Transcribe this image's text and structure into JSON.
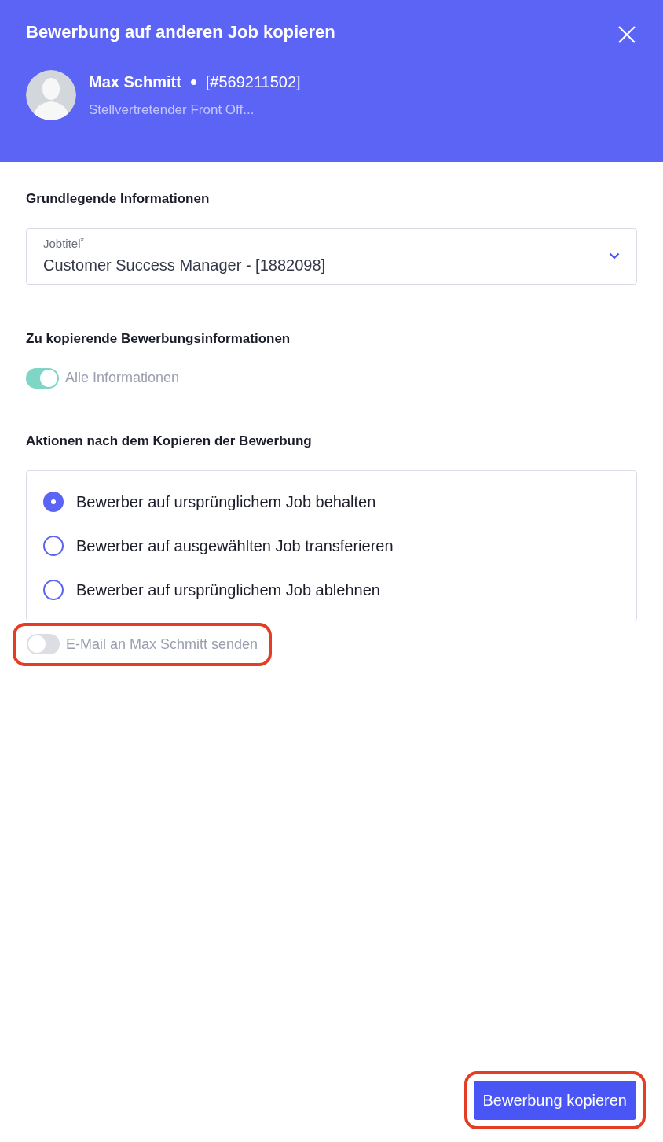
{
  "header": {
    "title": "Bewerbung auf anderen Job kopieren",
    "candidate": {
      "name": "Max Schmitt",
      "id": "[#569211502]",
      "position": "Stellvertretender Front Off..."
    }
  },
  "sections": [
    {
      "kind": "select",
      "heading": "Grundlegende Informationen",
      "label": "Jobtitel",
      "required_mark": "*",
      "value": "Customer Success Manager - [1882098]"
    },
    {
      "kind": "toggle",
      "heading": "Zu kopierende Bewerbungsinformationen",
      "label": "Alle Informationen",
      "on": true
    },
    {
      "kind": "radios",
      "heading": "Aktionen nach dem Kopieren der Bewerbung",
      "options": [
        {
          "label": "Bewerber auf ursprünglichem Job behalten",
          "selected": true
        },
        {
          "label": "Bewerber auf ausgewählten Job transferieren",
          "selected": false
        },
        {
          "label": "Bewerber auf ursprünglichem Job ablehnen",
          "selected": false
        }
      ]
    },
    {
      "kind": "toggle",
      "label": "E-Mail an Max Schmitt senden",
      "on": false,
      "highlighted": true
    }
  ],
  "submit": {
    "label": "Bewerbung kopieren",
    "highlighted": true
  }
}
